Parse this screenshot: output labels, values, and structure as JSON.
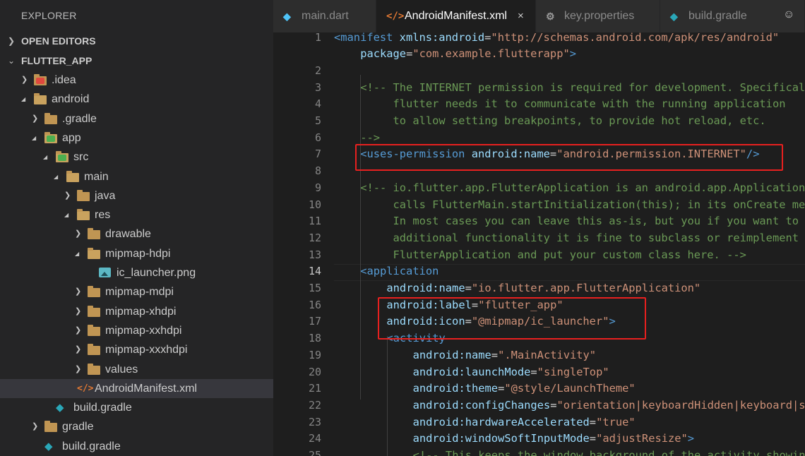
{
  "sidebar": {
    "title": "EXPLORER",
    "sections": {
      "open_editors": "OPEN EDITORS",
      "project": "FLUTTER_APP"
    },
    "tree": [
      {
        "label": ".idea",
        "depth": 1,
        "kind": "folder",
        "badge": "idea",
        "expanded": false
      },
      {
        "label": "android",
        "depth": 1,
        "kind": "folder",
        "expanded": true
      },
      {
        "label": ".gradle",
        "depth": 2,
        "kind": "folder",
        "expanded": false
      },
      {
        "label": "app",
        "depth": 2,
        "kind": "folder",
        "badge": "app",
        "expanded": true
      },
      {
        "label": "src",
        "depth": 3,
        "kind": "folder",
        "badge": "src",
        "expanded": true
      },
      {
        "label": "main",
        "depth": 4,
        "kind": "folder",
        "expanded": true
      },
      {
        "label": "java",
        "depth": 5,
        "kind": "folder",
        "expanded": false
      },
      {
        "label": "res",
        "depth": 5,
        "kind": "folder",
        "expanded": true
      },
      {
        "label": "drawable",
        "depth": 6,
        "kind": "folder",
        "expanded": false
      },
      {
        "label": "mipmap-hdpi",
        "depth": 6,
        "kind": "folder",
        "expanded": true
      },
      {
        "label": "ic_launcher.png",
        "depth": 7,
        "kind": "image"
      },
      {
        "label": "mipmap-mdpi",
        "depth": 6,
        "kind": "folder",
        "expanded": false
      },
      {
        "label": "mipmap-xhdpi",
        "depth": 6,
        "kind": "folder",
        "expanded": false
      },
      {
        "label": "mipmap-xxhdpi",
        "depth": 6,
        "kind": "folder",
        "expanded": false
      },
      {
        "label": "mipmap-xxxhdpi",
        "depth": 6,
        "kind": "folder",
        "expanded": false
      },
      {
        "label": "values",
        "depth": 6,
        "kind": "folder",
        "expanded": false
      },
      {
        "label": "AndroidManifest.xml",
        "depth": 5,
        "kind": "xml",
        "selected": true
      },
      {
        "label": "build.gradle",
        "depth": 3,
        "kind": "gradle"
      },
      {
        "label": "gradle",
        "depth": 2,
        "kind": "folder",
        "expanded": false
      },
      {
        "label": "build.gradle",
        "depth": 2,
        "kind": "gradle"
      }
    ]
  },
  "tabs": [
    {
      "label": "main.dart",
      "icon": "dart-icon",
      "active": false
    },
    {
      "label": "AndroidManifest.xml",
      "icon": "xml-icon",
      "active": true,
      "close": "×"
    },
    {
      "label": "key.properties",
      "icon": "gear-icon",
      "active": false
    },
    {
      "label": "build.gradle",
      "icon": "gradle-icon",
      "active": false
    }
  ],
  "editor": {
    "current_line": 14,
    "lines": [
      {
        "n": 1,
        "indent": 0,
        "tokens": [
          [
            "tag",
            "<manifest "
          ],
          [
            "attr",
            "xmlns:android"
          ],
          [
            "plain",
            "="
          ],
          [
            "str",
            "\"http://schemas.android.com/apk/res/android\""
          ]
        ]
      },
      {
        "n": "",
        "indent": 4,
        "tokens": [
          [
            "attr",
            "package"
          ],
          [
            "plain",
            "="
          ],
          [
            "str",
            "\"com.example.flutterapp\""
          ],
          [
            "tag",
            ">"
          ]
        ]
      },
      {
        "n": 2,
        "indent": 0,
        "tokens": []
      },
      {
        "n": 3,
        "indent": 4,
        "tokens": [
          [
            "cmt",
            "<!-- The INTERNET permission is required for development. Specifically,"
          ]
        ]
      },
      {
        "n": 4,
        "indent": 4,
        "tokens": [
          [
            "cmt",
            "     flutter needs it to communicate with the running application"
          ]
        ]
      },
      {
        "n": 5,
        "indent": 4,
        "tokens": [
          [
            "cmt",
            "     to allow setting breakpoints, to provide hot reload, etc."
          ]
        ]
      },
      {
        "n": 6,
        "indent": 4,
        "tokens": [
          [
            "cmt",
            "-->"
          ]
        ]
      },
      {
        "n": 7,
        "indent": 4,
        "tokens": [
          [
            "tag",
            "<uses-permission "
          ],
          [
            "attr",
            "android:name"
          ],
          [
            "plain",
            "="
          ],
          [
            "str",
            "\"android.permission.INTERNET\""
          ],
          [
            "tag",
            "/>"
          ]
        ]
      },
      {
        "n": 8,
        "indent": 0,
        "tokens": []
      },
      {
        "n": 9,
        "indent": 4,
        "tokens": [
          [
            "cmt",
            "<!-- io.flutter.app.FlutterApplication is an android.app.Application that"
          ]
        ]
      },
      {
        "n": 10,
        "indent": 4,
        "tokens": [
          [
            "cmt",
            "     calls FlutterMain.startInitialization(this); in its onCreate method."
          ]
        ]
      },
      {
        "n": 11,
        "indent": 4,
        "tokens": [
          [
            "cmt",
            "     In most cases you can leave this as-is, but you if you want to provide"
          ]
        ]
      },
      {
        "n": 12,
        "indent": 4,
        "tokens": [
          [
            "cmt",
            "     additional functionality it is fine to subclass or reimplement"
          ]
        ]
      },
      {
        "n": 13,
        "indent": 4,
        "tokens": [
          [
            "cmt",
            "     FlutterApplication and put your custom class here. -->"
          ]
        ]
      },
      {
        "n": 14,
        "indent": 4,
        "tokens": [
          [
            "tag",
            "<application"
          ]
        ]
      },
      {
        "n": 15,
        "indent": 8,
        "tokens": [
          [
            "attr",
            "android:name"
          ],
          [
            "plain",
            "="
          ],
          [
            "str",
            "\"io.flutter.app.FlutterApplication\""
          ]
        ]
      },
      {
        "n": 16,
        "indent": 8,
        "tokens": [
          [
            "attr",
            "android:label"
          ],
          [
            "plain",
            "="
          ],
          [
            "str",
            "\"flutter_app\""
          ]
        ]
      },
      {
        "n": 17,
        "indent": 8,
        "tokens": [
          [
            "attr",
            "android:icon"
          ],
          [
            "plain",
            "="
          ],
          [
            "str",
            "\"@mipmap/ic_launcher\""
          ],
          [
            "tag",
            ">"
          ]
        ]
      },
      {
        "n": 18,
        "indent": 8,
        "tokens": [
          [
            "tag",
            "<activity"
          ]
        ]
      },
      {
        "n": 19,
        "indent": 12,
        "tokens": [
          [
            "attr",
            "android:name"
          ],
          [
            "plain",
            "="
          ],
          [
            "str",
            "\".MainActivity\""
          ]
        ]
      },
      {
        "n": 20,
        "indent": 12,
        "tokens": [
          [
            "attr",
            "android:launchMode"
          ],
          [
            "plain",
            "="
          ],
          [
            "str",
            "\"singleTop\""
          ]
        ]
      },
      {
        "n": 21,
        "indent": 12,
        "tokens": [
          [
            "attr",
            "android:theme"
          ],
          [
            "plain",
            "="
          ],
          [
            "str",
            "\"@style/LaunchTheme\""
          ]
        ]
      },
      {
        "n": 22,
        "indent": 12,
        "tokens": [
          [
            "attr",
            "android:configChanges"
          ],
          [
            "plain",
            "="
          ],
          [
            "str",
            "\"orientation|keyboardHidden|keyboard|screenSize\""
          ]
        ]
      },
      {
        "n": 23,
        "indent": 12,
        "tokens": [
          [
            "attr",
            "android:hardwareAccelerated"
          ],
          [
            "plain",
            "="
          ],
          [
            "str",
            "\"true\""
          ]
        ]
      },
      {
        "n": 24,
        "indent": 12,
        "tokens": [
          [
            "attr",
            "android:windowSoftInputMode"
          ],
          [
            "plain",
            "="
          ],
          [
            "str",
            "\"adjustResize\""
          ],
          [
            "tag",
            ">"
          ]
        ]
      },
      {
        "n": 25,
        "indent": 12,
        "tokens": [
          [
            "cmt",
            "<!-- This keeps the window background of the activity showing"
          ]
        ]
      }
    ]
  },
  "colors": {
    "highlight": "#e8201f",
    "tag": "#569cd6",
    "attr": "#9cdcfe",
    "string": "#ce9178",
    "comment": "#6a9955"
  }
}
